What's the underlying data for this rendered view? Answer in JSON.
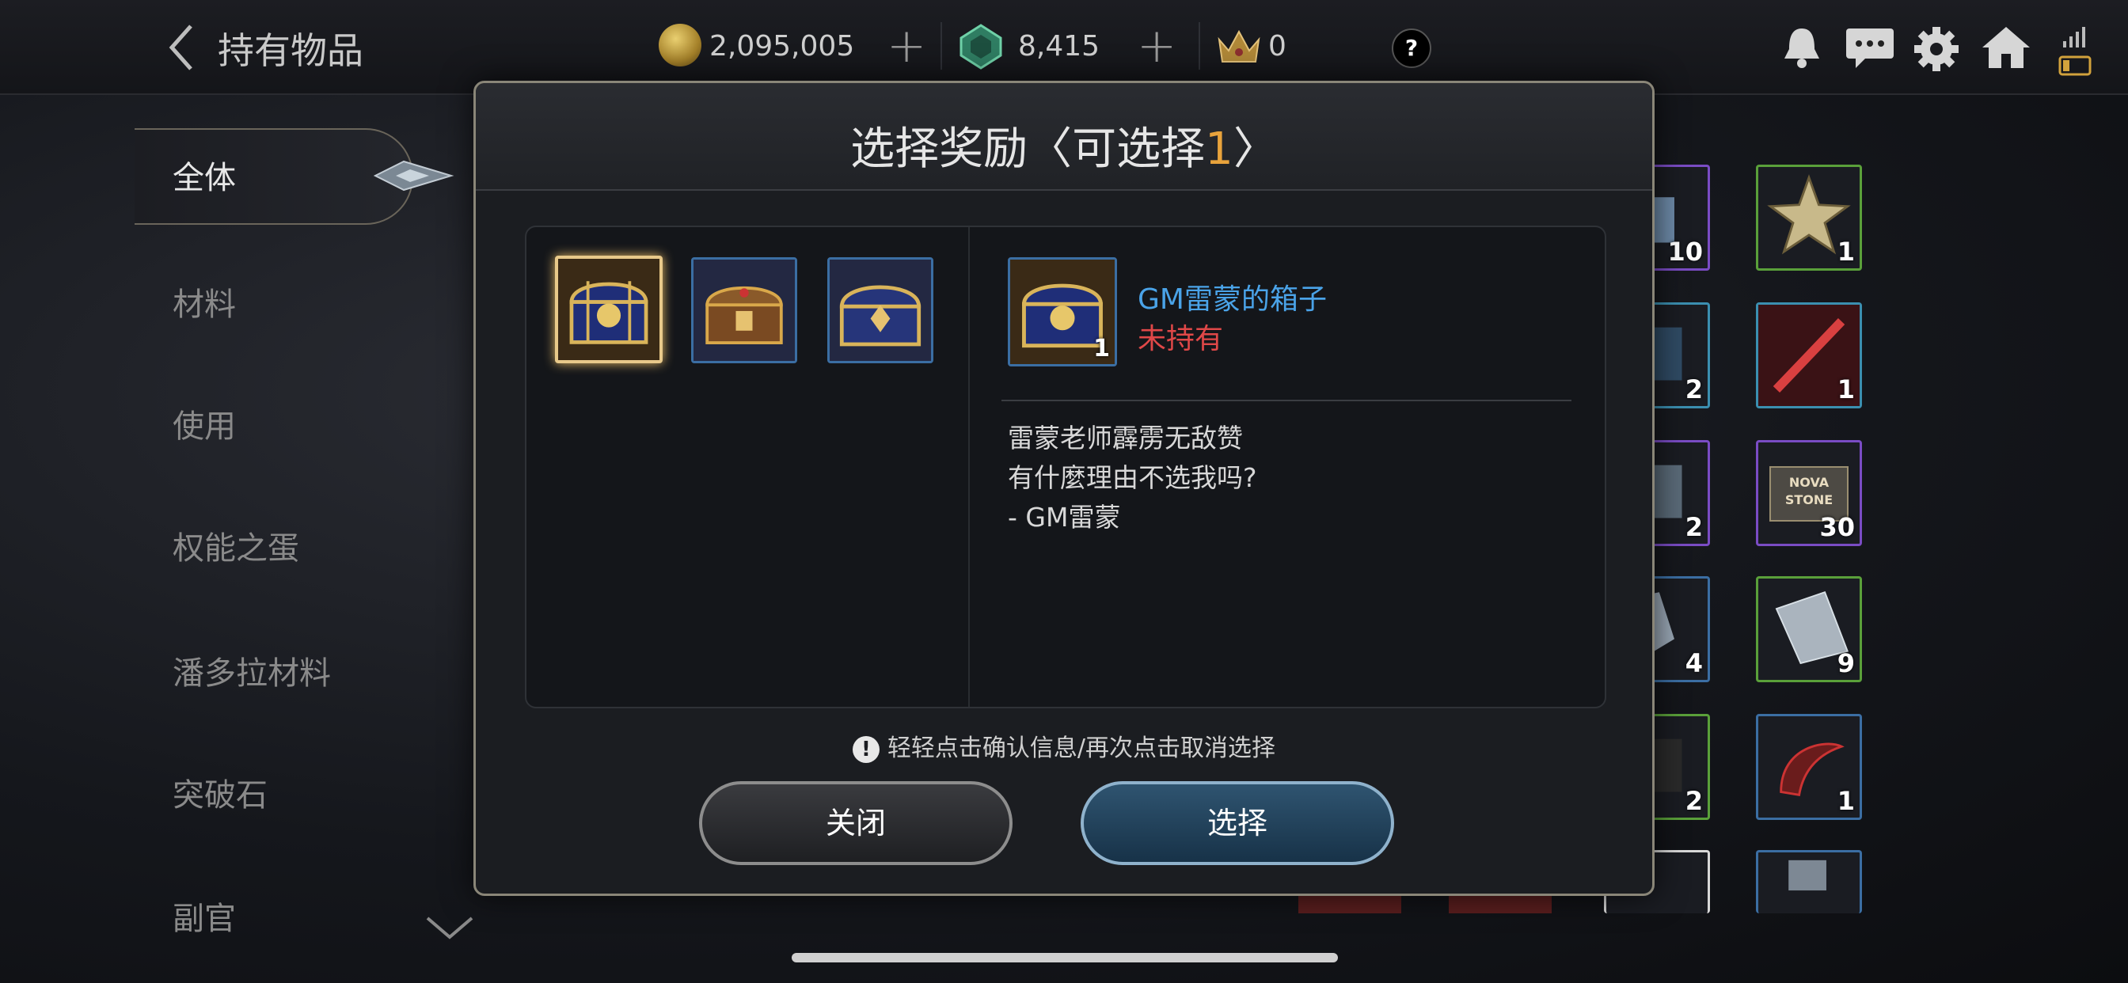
{
  "header": {
    "title": "持有物品",
    "gold": "2,095,005",
    "gems": "8,415",
    "crowns": "0",
    "help": "?"
  },
  "sidebar": {
    "items": [
      "全体",
      "材料",
      "使用",
      "权能之蛋",
      "潘多拉材料",
      "突破石",
      "副官"
    ]
  },
  "grid": {
    "items": [
      {
        "count": "10",
        "color": "#7a4cc4"
      },
      {
        "count": "1",
        "color": "#5aa03a"
      },
      {
        "count": "2",
        "color": "#3b8fb0"
      },
      {
        "count": "1",
        "color": "#3b8fb0"
      },
      {
        "count": "2",
        "color": "#7a4cc4"
      },
      {
        "count": "30",
        "color": "#7a4cc4"
      },
      {
        "count": "4",
        "color": "#3b6ea3"
      },
      {
        "count": "9",
        "color": "#5aa03a"
      },
      {
        "count": "2",
        "color": "#5aa03a"
      },
      {
        "count": "1",
        "color": "#3b6ea3"
      }
    ],
    "stone_label": "NOVA STONE"
  },
  "modal": {
    "title_prefix": "选择奖励〈可选择",
    "title_count": "1",
    "title_suffix": "〉",
    "detail": {
      "name": "GM雷蒙的箱子",
      "status": "未持有",
      "count": "1",
      "description": [
        "雷蒙老师霹雳无敌赞",
        "有什麼理由不选我吗?",
        "- GM雷蒙"
      ]
    },
    "hint": "轻轻点击确认信息/再次点击取消选择",
    "close_label": "关闭",
    "select_label": "选择"
  },
  "colors": {
    "accent_gold": "#e8a33c",
    "name_blue": "#4aa3e8",
    "status_red": "#e04848"
  }
}
